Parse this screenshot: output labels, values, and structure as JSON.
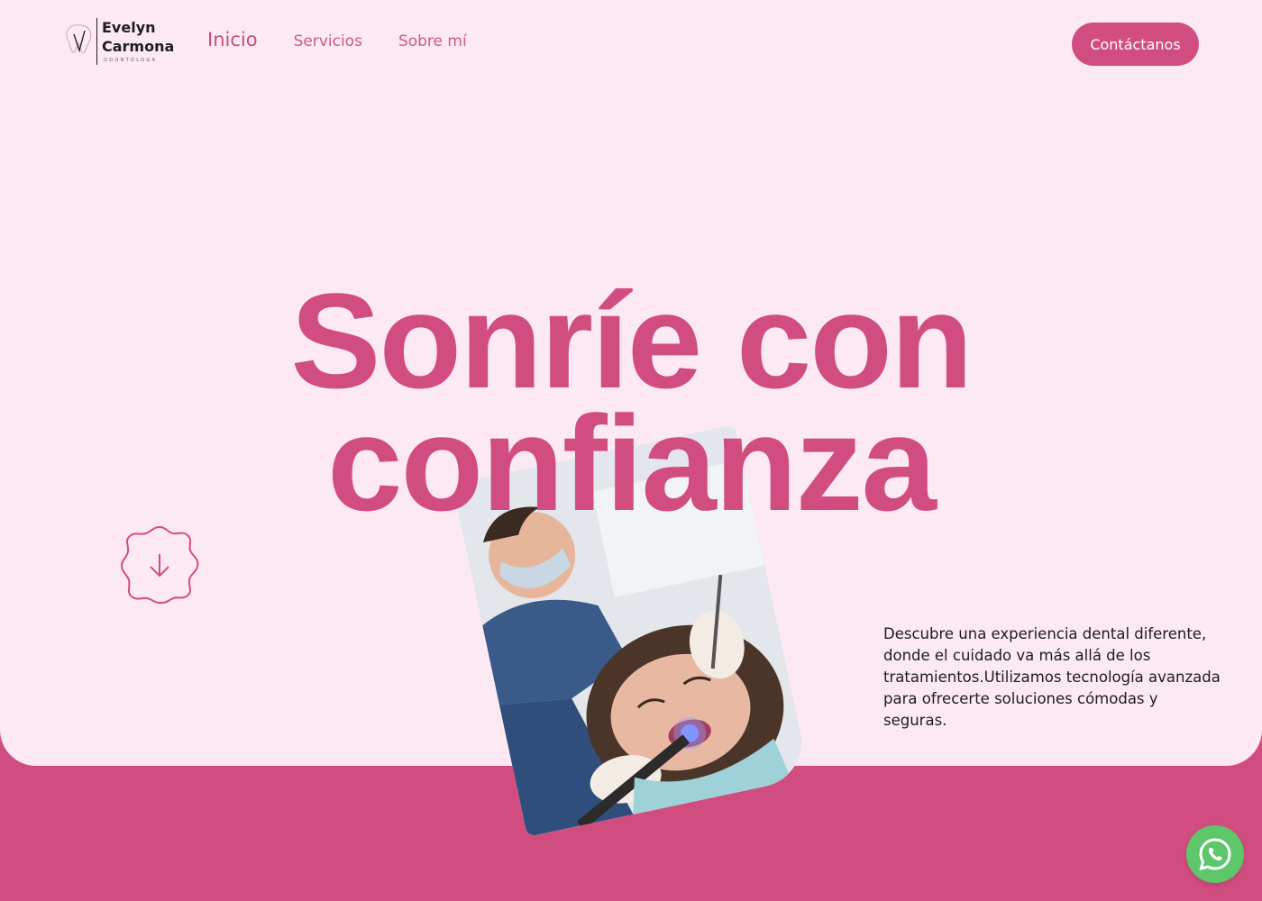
{
  "brand": {
    "name": "Evelyn Carmona",
    "subtitle": "ODONTÓLOGA"
  },
  "nav": {
    "items": [
      {
        "label": "Inicio",
        "active": true
      },
      {
        "label": "Servicios",
        "active": false
      },
      {
        "label": "Sobre mí",
        "active": false
      }
    ],
    "contact_label": "Contáctanos"
  },
  "hero": {
    "line1": "Sonríe con",
    "line2": "confianza",
    "description": "Descubre una experiencia dental diferente, donde el cuidado va más allá de los tratamientos.Utilizamos tecnología avanzada para ofrecerte soluciones cómodas y seguras."
  },
  "icons": {
    "logo": "tooth-icon",
    "scroll": "arrow-down-icon",
    "chat": "whatsapp-icon"
  },
  "colors": {
    "brand_pink": "#d14d80",
    "background": "#fce9f3",
    "whatsapp_green": "#5ec76a",
    "text_dark": "#1d1d1d"
  }
}
